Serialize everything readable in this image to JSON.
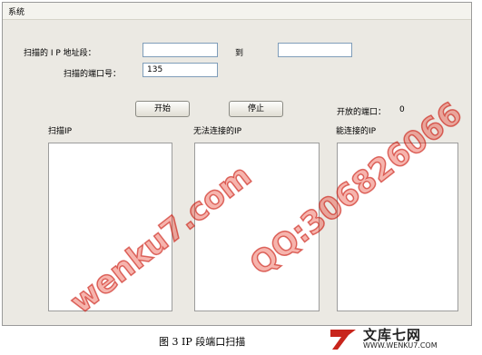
{
  "menu": {
    "system": "系统"
  },
  "form": {
    "ip_range_label": "扫描的 I P 地址段：",
    "ip_start_value": "",
    "to_label": "到",
    "ip_end_value": "",
    "port_label": "扫描的端口号：",
    "port_value": "135"
  },
  "buttons": {
    "start": "开始",
    "stop": "停止"
  },
  "status": {
    "open_ports_label": "开放的端口：",
    "open_ports_value": "0"
  },
  "lists": {
    "scan_ip": "扫描IP",
    "unreachable_ip": "无法连接的IP",
    "reachable_ip": "能连接的IP"
  },
  "caption": "图 3  IP 段端口扫描",
  "logo": {
    "name": "文库七网",
    "url": "WWW.WENKU7.COM"
  },
  "watermarks": [
    "wenku7.com",
    "QQ:306826066"
  ]
}
